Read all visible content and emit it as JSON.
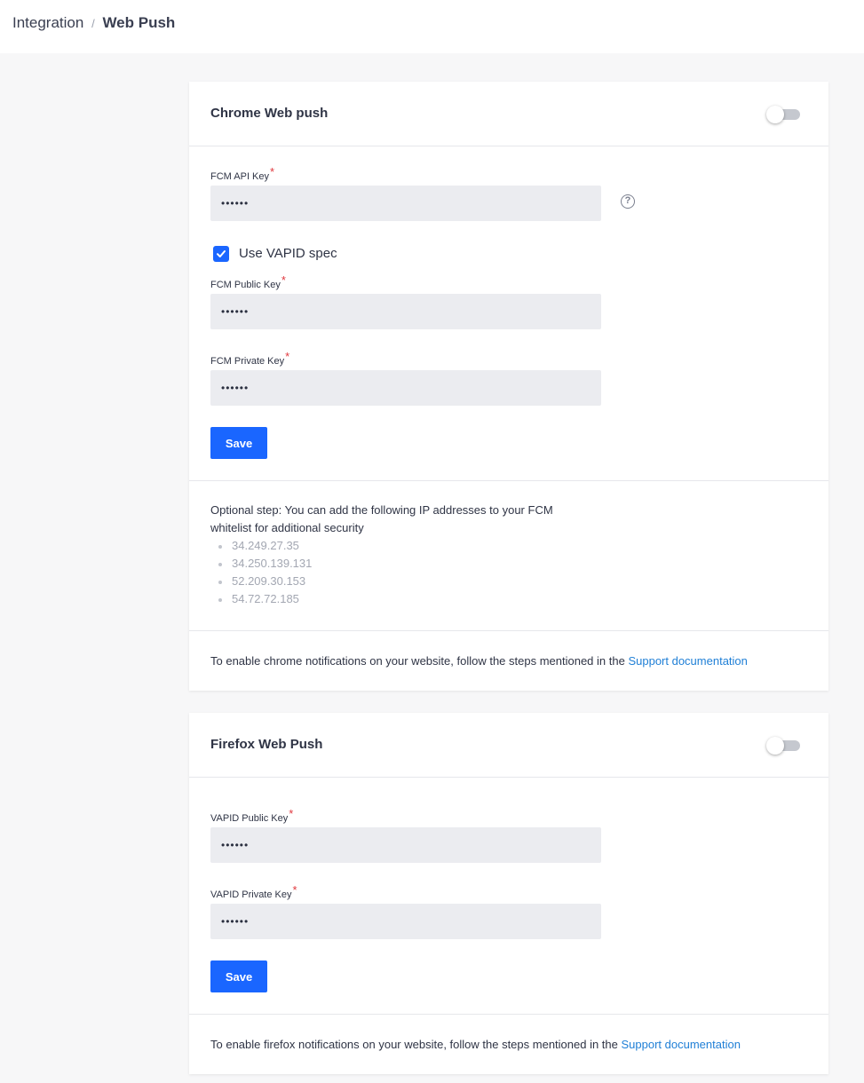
{
  "breadcrumb": {
    "parent": "Integration",
    "separator": "/",
    "current": "Web Push"
  },
  "chrome": {
    "title": "Chrome Web push",
    "toggle_enabled": false,
    "fcm_api_key": {
      "label": "FCM API Key",
      "required": "*",
      "value": "••••••"
    },
    "help_icon": "?",
    "use_vapid": {
      "label": "Use VAPID spec",
      "checked": true
    },
    "fcm_public_key": {
      "label": "FCM Public Key",
      "required": "*",
      "value": "••••••"
    },
    "fcm_private_key": {
      "label": "FCM Private Key",
      "required": "*",
      "value": "••••••"
    },
    "save_label": "Save",
    "optional_text": "Optional step: You can add the following IP addresses to your FCM whitelist for additional security",
    "ips": [
      "34.249.27.35",
      "34.250.139.131",
      "52.209.30.153",
      "54.72.72.185"
    ],
    "footer_text": "To enable chrome notifications on your website, follow the steps mentioned in the",
    "footer_link": "Support documentation"
  },
  "firefox": {
    "title": "Firefox Web Push",
    "toggle_enabled": false,
    "vapid_public_key": {
      "label": "VAPID Public Key",
      "required": "*",
      "value": "••••••"
    },
    "vapid_private_key": {
      "label": "VAPID Private Key",
      "required": "*",
      "value": "••••••"
    },
    "save_label": "Save",
    "footer_text": "To enable firefox notifications on your website, follow the steps mentioned in the",
    "footer_link": "Support documentation"
  },
  "colors": {
    "accent": "#1a66ff",
    "link": "#1f7fd6",
    "required": "#e0383e"
  }
}
